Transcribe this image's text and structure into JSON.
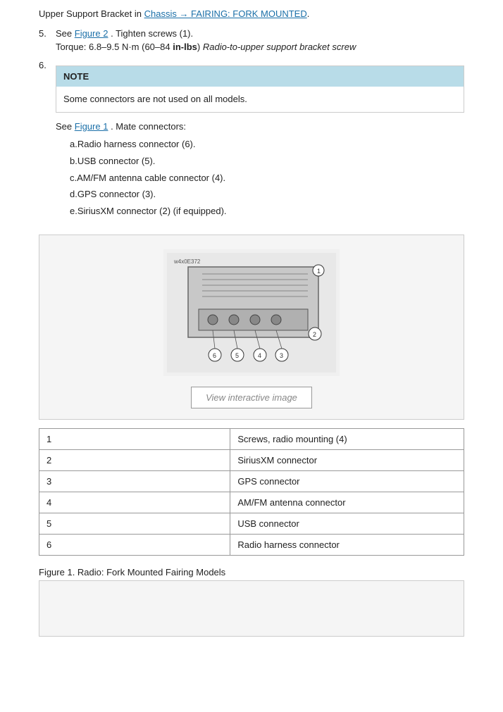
{
  "page": {
    "intro_line": "Upper Support Bracket in",
    "link1_text": "Chassis → FAIRING: FORK MOUNTED",
    "link1_href": "#",
    "steps": [
      {
        "number": "5.",
        "content": "See",
        "link_text": "Figure 2",
        "link_href": "#",
        "after_link": ". Tighten screws (1).",
        "sub": "Torque: 6.8–9.5 N·m (60–84 ",
        "sub_bold": "in-lbs",
        "sub_italic": " Radio-to-upper support bracket screw"
      },
      {
        "number": "6.",
        "content": ""
      }
    ],
    "note": {
      "header": "NOTE",
      "body": "Some connectors are not used on all models."
    },
    "see_figure_line": "See",
    "see_figure_link": "Figure 1",
    "see_figure_after": ". Mate connectors:",
    "alpha_items": [
      {
        "label": "a.",
        "text": "Radio harness connector (6)."
      },
      {
        "label": "b.",
        "text": "USB connector (5)."
      },
      {
        "label": "c.",
        "text": "AM/FM antenna cable connector (4)."
      },
      {
        "label": "d.",
        "text": "GPS connector (3)."
      },
      {
        "label": "e.",
        "text": "SiriusXM connector (2) (if equipped)."
      }
    ],
    "view_button_label": "View interactive image",
    "table_rows": [
      {
        "num": "1",
        "desc": "Screws, radio mounting (4)"
      },
      {
        "num": "2",
        "desc": "SiriusXM connector"
      },
      {
        "num": "3",
        "desc": "GPS connector"
      },
      {
        "num": "4",
        "desc": "AM/FM antenna connector"
      },
      {
        "num": "5",
        "desc": "USB connector"
      },
      {
        "num": "6",
        "desc": "Radio harness connector"
      }
    ],
    "figure_caption": "Figure 1. Radio: Fork Mounted Fairing Models",
    "figure_id": "w4x0E372"
  }
}
